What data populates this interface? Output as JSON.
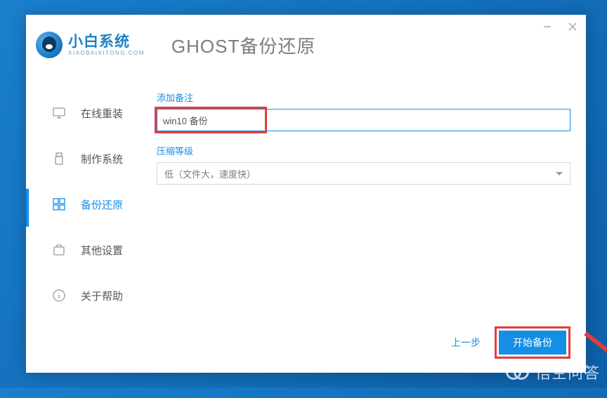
{
  "logo": {
    "main": "小白系统",
    "sub": "XIAOBAIXITONG.COM"
  },
  "page_title": "GHOST备份还原",
  "sidebar": {
    "items": [
      {
        "label": "在线重装"
      },
      {
        "label": "制作系统"
      },
      {
        "label": "备份还原"
      },
      {
        "label": "其他设置"
      },
      {
        "label": "关于帮助"
      }
    ]
  },
  "form": {
    "remark_label": "添加备注",
    "remark_value": "win10 备份",
    "compress_label": "压缩等级",
    "compress_value": "低（文件大，速度快）"
  },
  "buttons": {
    "prev": "上一步",
    "start": "开始备份"
  },
  "watermark": "悟空问答",
  "colors": {
    "accent": "#148fe6",
    "highlight": "#e43c3c"
  }
}
